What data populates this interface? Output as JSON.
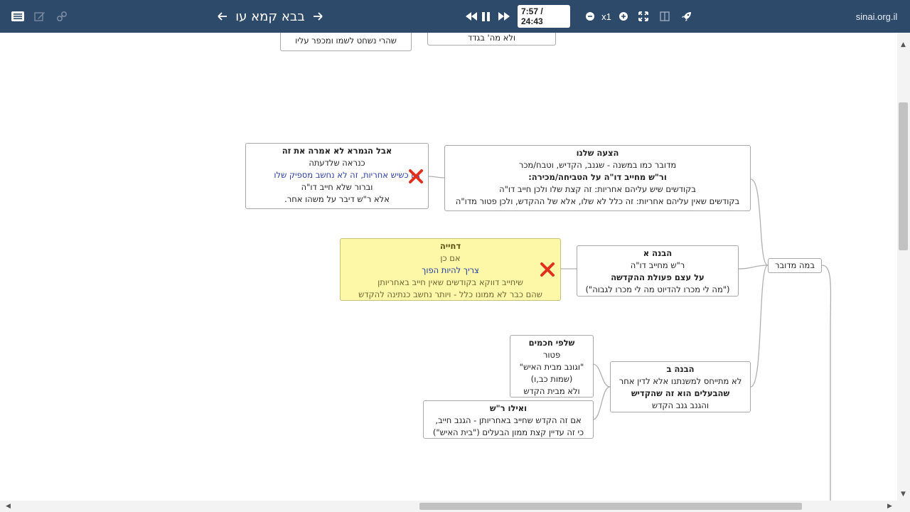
{
  "toolbar": {
    "title": "בבא קמא עו",
    "time": "7:57 / 24:43",
    "zoom": "x1",
    "site": "sinai.org.il"
  },
  "nodes": {
    "top_left": {
      "l1": "שהרי נשחט לשמו ומכפר עליו"
    },
    "top_right": {
      "l1": "ולא מה' בגדד"
    },
    "proposal": {
      "title": "הצעה שלנו",
      "l1": "מדובר כמו במשנה - שגנב, הקדיש, וטבח/מכר",
      "l2": "ור\"ש מחייב דו\"ה על הטביחה/מכירה:",
      "l3": "בקודשים שיש עליהם אחריות: זה קצת שלו ולכן חייב דו\"ה",
      "l4": "בקודשים שאין עליהם אחריות: זה כלל לא שלו, אלא של ההקדש, ולכן פטור מדו\"ה"
    },
    "objection": {
      "title": "אבל הגמרא לא אמרה את זה",
      "l1": "כנראה שלדעתה",
      "l2": "גם כשיש אחריות, זה לא נחשב מספיק שלו",
      "l3": "וברור שלא חייב דו\"ה",
      "l4": "אלא ר\"ש דיבר על משהו אחר."
    },
    "rejection": {
      "title": "דחייה",
      "l1": "אם כן",
      "l2": "צריך להיות הפוך",
      "l3": "שיחייב דווקא בקודשים שאין חייב באחריותן",
      "l4": "שהם כבר לא ממונו כלל - ויותר נחשב כנתינה להקדש"
    },
    "option_a": {
      "title": "הבנה א",
      "l1": "ר\"ש מחייב דו\"ה",
      "l2": "על עצם פעולת ההקדשה",
      "l3": "(\"מה לי מכרו להדיוט מה לי מכרו לגבוה\")"
    },
    "root": {
      "label": "במה מדובר"
    },
    "option_b": {
      "title": "הבנה ב",
      "l1": "לא מתייחס למשנתנו אלא לדין אחר",
      "l2": "שהבעלים הוא זה שהקדיש",
      "l3": "והגנב גנב הקדש"
    },
    "sages": {
      "title": "שלפי חכמים",
      "l1": "פטור",
      "l2": "\"וגונב מבית האיש\"",
      "l3": "(שמות כב,ו)",
      "l4": "ולא מבית הקדש"
    },
    "rs": {
      "title": "ואילו ר\"ש",
      "l1": "אם זה הקדש שחייב באחריותן - הגנב חייב,",
      "l2": "כי זה עדיין קצת ממון הבעלים (\"בית האיש\")"
    }
  },
  "colors": {
    "toolbar_bg": "#2e4a6b",
    "highlight_bg": "#fdf7a8",
    "x_mark": "#e0301e",
    "link_line": "#b0b0b0"
  }
}
